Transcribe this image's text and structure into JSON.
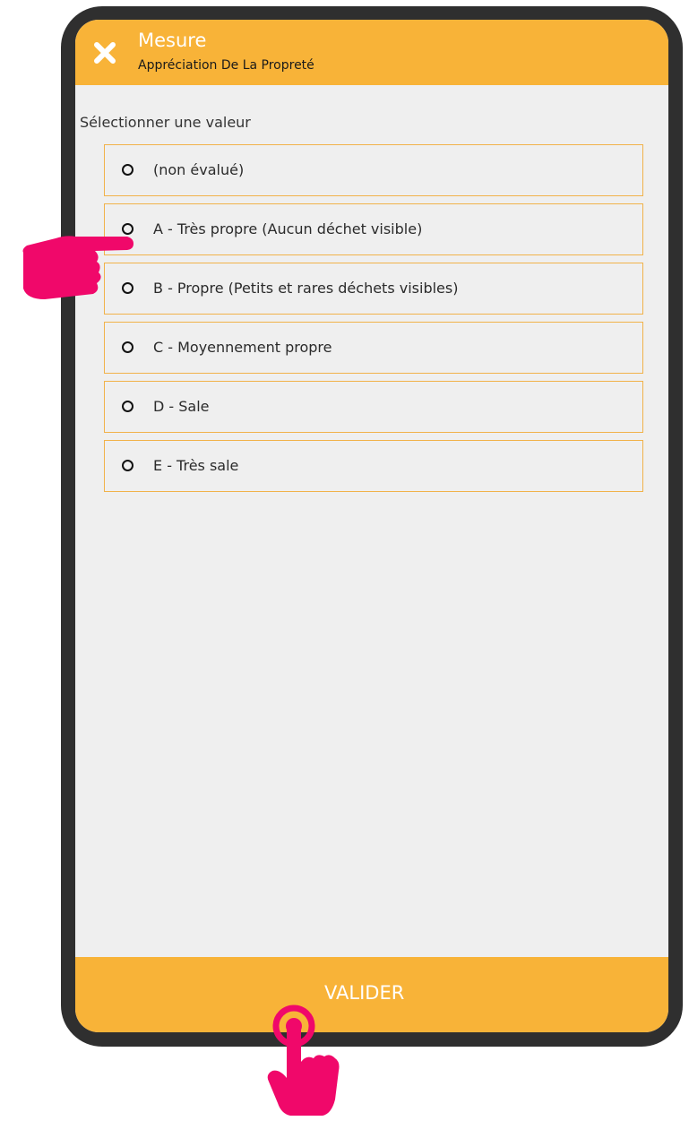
{
  "header": {
    "title": "Mesure",
    "subtitle": "Appréciation De La Propreté",
    "close_icon": "close-icon"
  },
  "prompt": "Sélectionner une valeur",
  "options": [
    {
      "label": "(non évalué)",
      "selected": false
    },
    {
      "label": "A - Très propre (Aucun déchet visible)",
      "selected": false
    },
    {
      "label": "B - Propre (Petits et rares déchets visibles)",
      "selected": false
    },
    {
      "label": "C - Moyennement propre",
      "selected": false
    },
    {
      "label": "D - Sale",
      "selected": false
    },
    {
      "label": "E - Très sale",
      "selected": false
    }
  ],
  "footer": {
    "validate_label": "VALIDER"
  },
  "overlay_icons": [
    "pointing-hand-icon",
    "tap-hand-icon"
  ],
  "colors": {
    "header_bg": "#f8b338",
    "screen_bg": "#efefef",
    "option_border": "#f1b24a",
    "device_frame": "#2f2f2f",
    "hand_accent": "#f0086a"
  }
}
